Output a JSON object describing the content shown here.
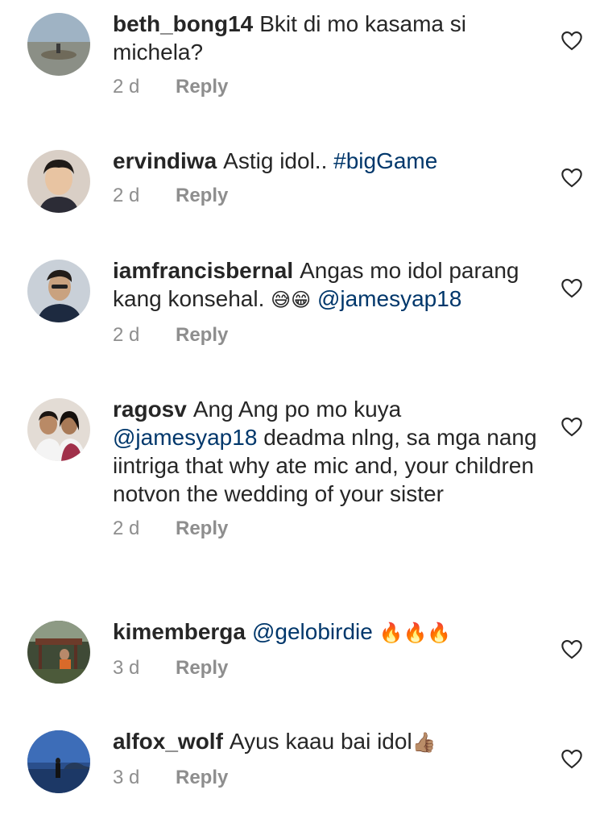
{
  "comments": [
    {
      "username": "beth_bong14",
      "text": "Bkit di mo kasama si michela?",
      "time": "2 d",
      "reply_label": "Reply"
    },
    {
      "username": "ervindiwa",
      "text": "Astig idol..",
      "hashtag": "#bigGame",
      "time": "2 d",
      "reply_label": "Reply"
    },
    {
      "username": "iamfrancisbernal",
      "text": "Angas mo idol parang kang konsehal.",
      "emojis": "😅😁",
      "mention": "@jamesyap18",
      "time": "2 d",
      "reply_label": "Reply"
    },
    {
      "username": "ragosv",
      "text_before": "Ang Ang po mo kuya",
      "mention": "@jamesyap18",
      "text_after": "deadma nlng, sa mga nang iintriga that why ate mic and, your children notvon the wedding of your sister",
      "time": "2 d",
      "reply_label": "Reply"
    },
    {
      "username": "kimemberga",
      "mention": "@gelobirdie",
      "emojis": "🔥🔥🔥",
      "time": "3 d",
      "reply_label": "Reply"
    },
    {
      "username": "alfox_wolf",
      "text": "Ayus kaau bai idol",
      "emojis": "👍🏽",
      "time": "3 d",
      "reply_label": "Reply"
    }
  ],
  "icons": {
    "like": "heart-outline-icon"
  },
  "colors": {
    "text": "#262626",
    "link": "#00376b",
    "meta": "#8e8e8e"
  }
}
